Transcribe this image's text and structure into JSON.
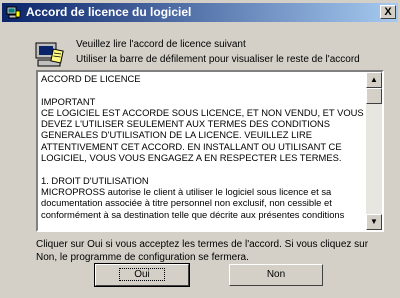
{
  "window": {
    "title": "Accord de licence du logiciel",
    "close_label": "X"
  },
  "header": {
    "line1": "Veuillez lire l'accord de licence suivant",
    "line2": "Utiliser la barre de défilement pour visualiser le reste de l'accord"
  },
  "license": {
    "text": "ACCORD DE LICENCE\n\nIMPORTANT\nCE LOGICIEL EST ACCORDE SOUS LICENCE, ET NON VENDU, ET VOUS DEVEZ L'UTILISER SEULEMENT AUX TERMES DES CONDITIONS GENERALES D'UTILISATION DE LA LICENCE. VEUILLEZ LIRE ATTENTIVEMENT CET ACCORD. EN INSTALLANT OU UTILISANT CE LOGICIEL, VOUS VOUS ENGAGEZ A EN RESPECTER LES TERMES.\n\n1. DROIT D'UTILISATION\nMICROPROSS autorise le client à utiliser le logiciel sous licence et sa documentation associée à titre personnel non exclusif, non cessible et conformément à sa destination telle que décrite aux présentes conditions"
  },
  "scrollbar": {
    "up_arrow": "▲",
    "down_arrow": "▼"
  },
  "footer": {
    "text": "Cliquer sur Oui si vous acceptez les termes de l'accord. Si vous cliquez sur Non, le programme de configuration se fermera."
  },
  "buttons": {
    "yes_label": "Oui",
    "no_label": "Non"
  }
}
